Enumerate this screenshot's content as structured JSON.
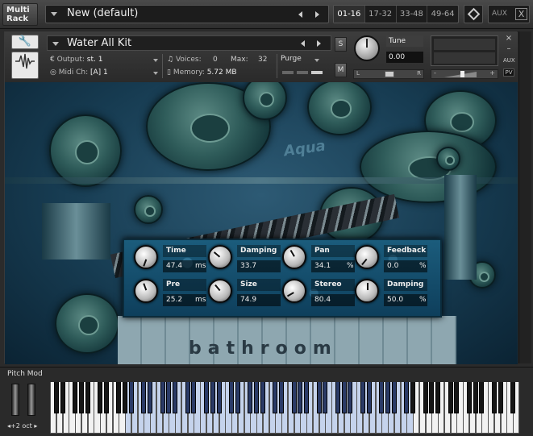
{
  "rack": {
    "title_line1": "Multi",
    "title_line2": "Rack",
    "name": "New (default)",
    "pages": [
      "01-16",
      "17-32",
      "33-48",
      "49-64"
    ],
    "active_page": "01-16",
    "aux_label": "AUX",
    "aux_close": "X"
  },
  "instrument": {
    "name": "Water All Kit",
    "output_label": "Output:",
    "output_value": "st. 1",
    "voices_label": "Voices:",
    "voices_value": "0",
    "max_label": "Max:",
    "max_value": "32",
    "purge_label": "Purge",
    "midi_label": "Midi Ch:",
    "midi_value": "[A]  1",
    "memory_label": "Memory:",
    "memory_value": "5.72 MB",
    "solo_label": "S",
    "mute_label": "M",
    "tune_label": "Tune",
    "tune_value": "0.00",
    "pan_left": "L",
    "pan_right": "R",
    "close_label": "×",
    "minimize_label": "–",
    "aux_label": "AUX",
    "pv_label": "PV",
    "vol_minus": "-",
    "vol_plus": "+"
  },
  "background": {
    "logo_text": "Aqua",
    "tiles_text": "bathroom"
  },
  "effects": {
    "params": [
      {
        "label": "Time",
        "value": "47.4",
        "unit": "ms",
        "knob_rotation_deg": -160
      },
      {
        "label": "Damping",
        "value": "33.7",
        "unit": "",
        "knob_rotation_deg": -50
      },
      {
        "label": "Pan",
        "value": "34.1",
        "unit": "%",
        "knob_rotation_deg": -30
      },
      {
        "label": "Feedback",
        "value": "0.0",
        "unit": "%",
        "knob_rotation_deg": -140
      },
      {
        "label": "Pre",
        "value": "25.2",
        "unit": "ms",
        "knob_rotation_deg": -20
      },
      {
        "label": "Size",
        "value": "74.9",
        "unit": "",
        "knob_rotation_deg": -40
      },
      {
        "label": "Stereo",
        "value": "80.4",
        "unit": "",
        "knob_rotation_deg": -120
      },
      {
        "label": "Damping",
        "value": "50.0",
        "unit": "%",
        "knob_rotation_deg": 0
      }
    ]
  },
  "keyboard": {
    "pitch_mod_label": "Pitch Mod",
    "octave_label": "◂+2 oct ▸",
    "white_key_count": 75,
    "highlight_white_range": [
      12,
      58
    ]
  },
  "colors": {
    "accent_blue": "#1b5c7c",
    "key_highlight": "#c5d3ec"
  }
}
